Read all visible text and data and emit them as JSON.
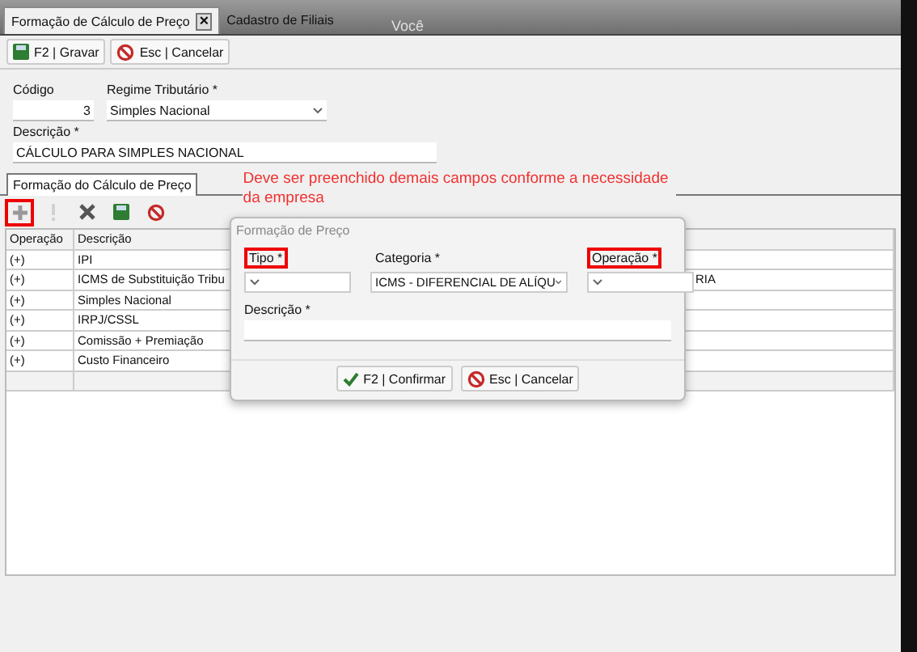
{
  "tabs": [
    {
      "label": "Formação de Cálculo de Preço",
      "selected": true,
      "close": "×"
    },
    {
      "label": "Cadastro de Filiais",
      "selected": false
    }
  ],
  "overlay_text": "Você",
  "toolbar": [
    {
      "kind": "save",
      "label": "F2 | Gravar"
    },
    {
      "kind": "cancel",
      "label": "Esc | Cancelar"
    }
  ],
  "form": {
    "codigo": {
      "label": "Código",
      "value": "3"
    },
    "regime": {
      "label": "Regime Tributário *",
      "value": "Simples Nacional"
    },
    "descricao": {
      "label": "Descrição *",
      "value": "CÁLCULO PARA SIMPLES NACIONAL"
    }
  },
  "inner_tab": {
    "label": "Formação do Cálculo de Preço",
    "selected": true
  },
  "annotation": "Deve ser preenchido demais campos conforme a necessidade da empresa",
  "grid_toolbar": [
    {
      "kind": "add",
      "highlighted": true,
      "disabled": false
    },
    {
      "kind": "alert",
      "highlighted": false,
      "disabled": true
    },
    {
      "kind": "delete",
      "highlighted": false,
      "disabled": false
    },
    {
      "kind": "save",
      "highlighted": false,
      "disabled": false
    },
    {
      "kind": "cancel",
      "highlighted": false,
      "disabled": false
    }
  ],
  "table": {
    "columns": [
      "Operação",
      "Descrição"
    ],
    "rows": [
      {
        "operacao": "(+)",
        "descricao": "IPI"
      },
      {
        "operacao": "(+)",
        "descricao": "ICMS de Substituição Tribu",
        "column_4": "RIA"
      },
      {
        "operacao": "(+)",
        "descricao": "Simples Nacional"
      },
      {
        "operacao": "(+)",
        "descricao": "IRPJ/CSSL"
      },
      {
        "operacao": "(+)",
        "descricao": "Comissão + Premiação"
      },
      {
        "operacao": "(+)",
        "descricao": "Custo Financeiro"
      }
    ]
  },
  "dialog": {
    "title": "Formação de Preço",
    "fields": [
      {
        "label": "Tipo *",
        "highlighted": true
      },
      {
        "label": "Categoria *",
        "value": "ICMS - DIFERENCIAL DE ALÍQU",
        "highlighted": false
      },
      {
        "label": "Operação *",
        "highlighted": true
      }
    ],
    "descricao": {
      "label": "Descrição *"
    },
    "buttons": [
      {
        "kind": "confirm",
        "label": "F2 | Confirmar"
      },
      {
        "kind": "cancel",
        "label": "Esc | Cancelar"
      }
    ]
  }
}
